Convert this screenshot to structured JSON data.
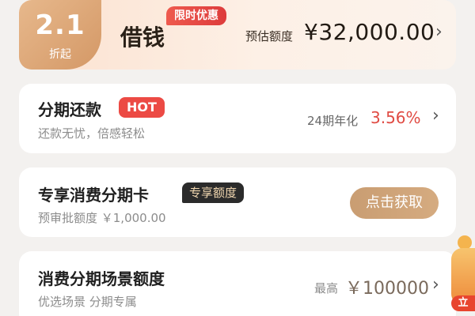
{
  "loan": {
    "discount_value": "2.1",
    "discount_unit": "折起",
    "title": "借钱",
    "promo_badge": "限时优惠",
    "estimate_label": "预估额度",
    "estimate_amount": "¥32,000.00"
  },
  "installment": {
    "title": "分期还款",
    "badge": "HOT",
    "subtitle": "还款无忧，倍感轻松",
    "rate_label": "24期年化",
    "rate_value": "3.56%"
  },
  "exclusive_card": {
    "title": "专享消费分期卡",
    "badge": "专享额度",
    "subtitle": "预审批额度 ￥1,000.00",
    "button_label": "点击获取"
  },
  "scene_quota": {
    "title": "消费分期场景额度",
    "subtitle": "优选场景 分期专属",
    "max_label": "最高",
    "max_value": "￥100000"
  },
  "float_widget": {
    "label": "立"
  },
  "icons": {
    "chevron": "chevron-right-icon",
    "gift": "gift-icon"
  },
  "colors": {
    "accent_gold": "#d49866",
    "hot_red": "#ec4a44",
    "rate_red": "#e04b43",
    "button_gold": "#c99d72"
  }
}
